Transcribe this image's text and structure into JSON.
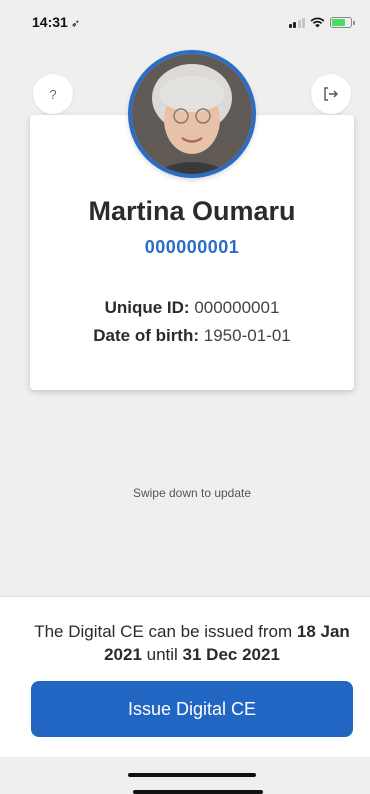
{
  "status_bar": {
    "time": "14:31",
    "location_glyph": "➶"
  },
  "header": {
    "help_label": "?",
    "logout_glyph": "[→"
  },
  "profile": {
    "name": "Martina Oumaru",
    "id_link": "000000001",
    "unique_id_label": "Unique ID:",
    "unique_id_value": "000000001",
    "dob_label": "Date of birth:",
    "dob_value": "1950-01-01"
  },
  "swipe_hint": "Swipe down to update",
  "issue": {
    "text_prefix": "The Digital CE can be issued from ",
    "date_from": "18 Jan 2021",
    "text_middle": " until ",
    "date_until": "31 Dec 2021",
    "button_label": "Issue Digital CE"
  },
  "colors": {
    "accent": "#2166c2",
    "background": "#efefef",
    "card": "#ffffff"
  },
  "icons": {
    "help": "question-icon",
    "logout": "logout-icon",
    "wifi": "wifi-icon",
    "battery": "battery-charging-icon",
    "signal": "signal-icon"
  }
}
